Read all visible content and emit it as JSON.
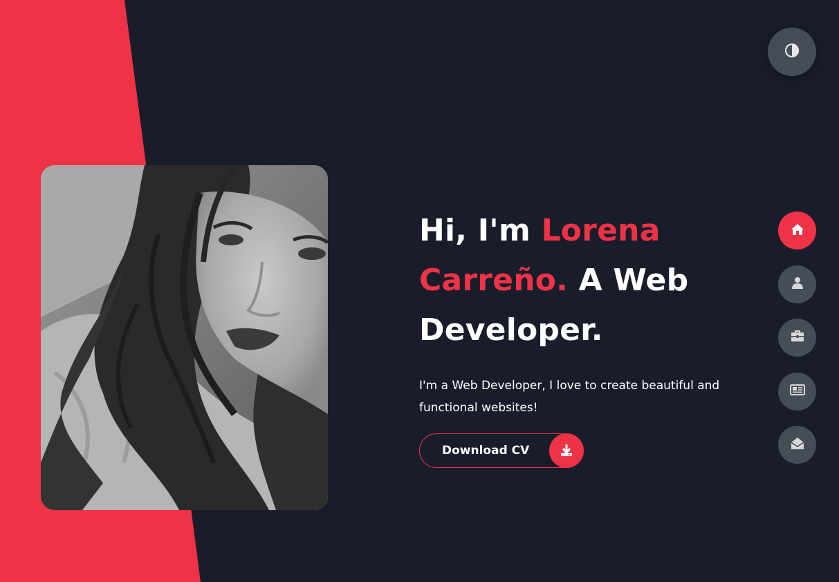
{
  "hero": {
    "greeting": "Hi, I'm ",
    "name": "Lorena Carreño.",
    "role": " A Web Developer.",
    "description": "I'm a Web Developer, I love to create beautiful and functional websites!"
  },
  "cv_button": {
    "label": "Download CV",
    "icon": "download-icon"
  },
  "theme_toggle": {
    "icon": "contrast-icon"
  },
  "nav": {
    "active": "home",
    "items": [
      {
        "icon": "home-icon",
        "section": "home"
      },
      {
        "icon": "user-icon",
        "section": "about"
      },
      {
        "icon": "briefcase-icon",
        "section": "portfolio"
      },
      {
        "icon": "newspaper-icon",
        "section": "blogs"
      },
      {
        "icon": "envelope-open-icon",
        "section": "contact"
      }
    ]
  },
  "colors": {
    "accent": "#ef3346",
    "background": "#191d2b",
    "nav_button": "#454e56",
    "text": "#ffffff"
  }
}
